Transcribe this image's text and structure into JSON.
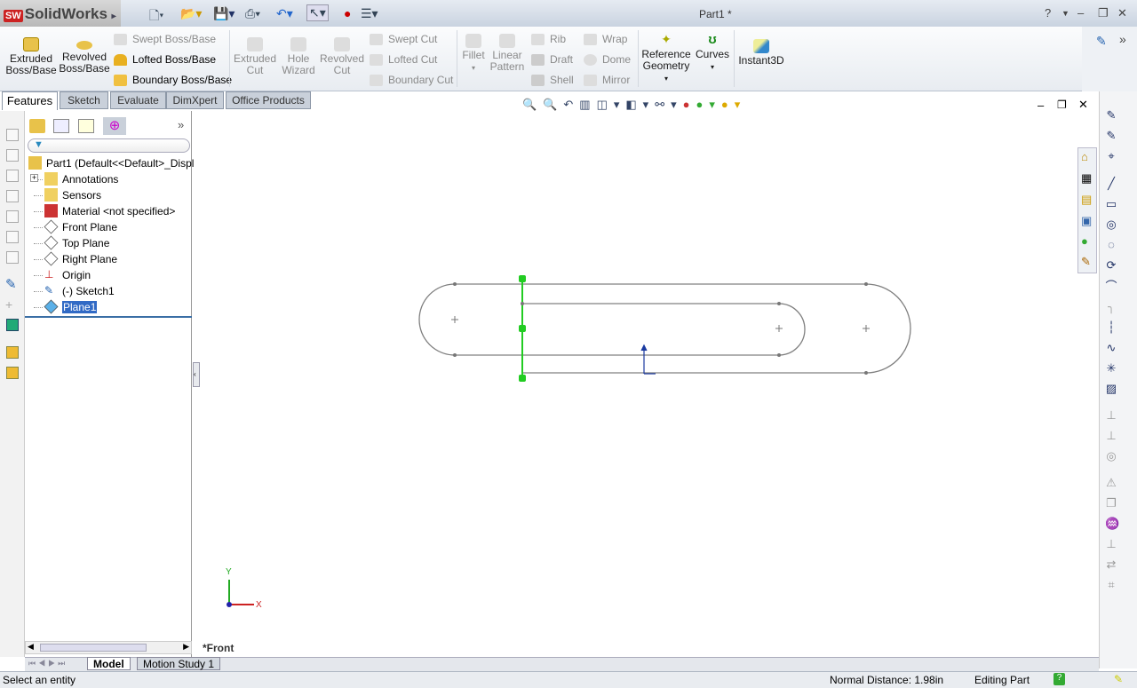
{
  "app": {
    "name": "SolidWorks",
    "title": "Part1 *",
    "help": "?"
  },
  "ribbon": {
    "extruded_boss": "Extruded Boss/Base",
    "revolved_boss": "Revolved Boss/Base",
    "swept_boss": "Swept Boss/Base",
    "lofted_boss": "Lofted Boss/Base",
    "boundary_boss": "Boundary Boss/Base",
    "extruded_cut": "Extruded Cut",
    "hole_wizard": "Hole Wizard",
    "revolved_cut": "Revolved Cut",
    "swept_cut": "Swept Cut",
    "lofted_cut": "Lofted Cut",
    "boundary_cut": "Boundary Cut",
    "fillet": "Fillet",
    "linear_pattern": "Linear Pattern",
    "rib": "Rib",
    "draft": "Draft",
    "shell": "Shell",
    "wrap": "Wrap",
    "dome": "Dome",
    "mirror": "Mirror",
    "reference_geometry": "Reference Geometry",
    "curves": "Curves",
    "instant3d": "Instant3D"
  },
  "tabs": [
    {
      "label": "Features",
      "active": true
    },
    {
      "label": "Sketch"
    },
    {
      "label": "Evaluate"
    },
    {
      "label": "DimXpert"
    },
    {
      "label": "Office Products"
    }
  ],
  "tree": {
    "items": [
      {
        "label": "Part1  (Default<<Default>_Displa",
        "icon": "part-icon"
      },
      {
        "label": "Annotations",
        "icon": "annotations-icon"
      },
      {
        "label": "Sensors",
        "icon": "sensors-icon"
      },
      {
        "label": "Material <not specified>",
        "icon": "material-icon"
      },
      {
        "label": "Front Plane",
        "icon": "plane-icon"
      },
      {
        "label": "Top Plane",
        "icon": "plane-icon"
      },
      {
        "label": "Right Plane",
        "icon": "plane-icon"
      },
      {
        "label": "Origin",
        "icon": "origin-icon"
      },
      {
        "label": "(-) Sketch1",
        "icon": "sketch-icon"
      },
      {
        "label": "Plane1",
        "icon": "plane-icon",
        "selected": true
      }
    ]
  },
  "viewport": {
    "view_label": "*Front",
    "axis_x": "X",
    "axis_y": "Y"
  },
  "bottom_tabs": [
    {
      "label": "Model",
      "active": true
    },
    {
      "label": "Motion Study 1"
    }
  ],
  "status": {
    "message": "Select an entity",
    "normal_distance": "Normal Distance: 1.98in",
    "mode": "Editing Part"
  },
  "colors": {
    "selection_green": "#22cc22",
    "sketch_line": "#808080",
    "accent": "#316ac5"
  }
}
